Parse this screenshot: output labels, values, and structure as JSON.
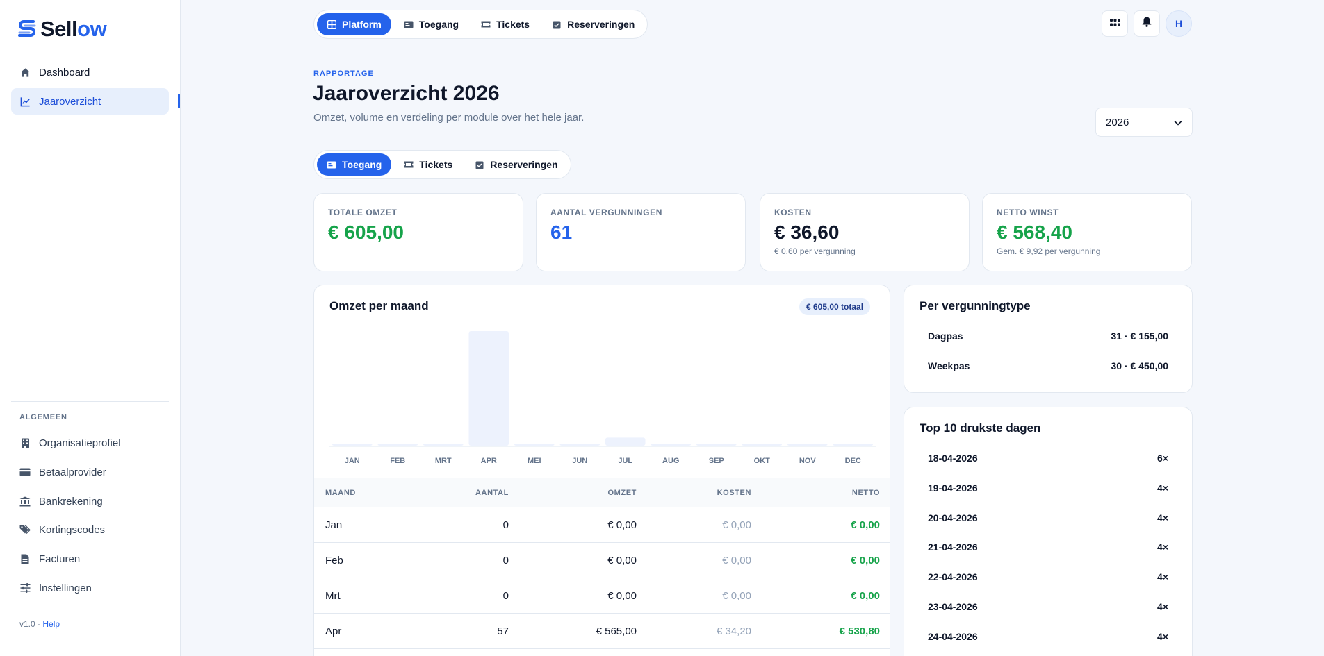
{
  "brand": {
    "prefix": "Sell",
    "suffix": "ow"
  },
  "sidebar": {
    "nav": [
      {
        "label": "Dashboard",
        "icon": "home-icon"
      },
      {
        "label": "Jaaroverzicht",
        "icon": "chart-line-icon"
      }
    ],
    "section_label": "ALGEMEEN",
    "settings": [
      {
        "label": "Organisatieprofiel",
        "icon": "building-icon"
      },
      {
        "label": "Betaalprovider",
        "icon": "credit-card-icon"
      },
      {
        "label": "Bankrekening",
        "icon": "bank-icon"
      },
      {
        "label": "Kortingscodes",
        "icon": "tags-icon"
      },
      {
        "label": "Facturen",
        "icon": "file-icon"
      },
      {
        "label": "Instellingen",
        "icon": "sliders-icon"
      }
    ],
    "version": "v1.0 ·",
    "help": "Help"
  },
  "topnav": {
    "tabs": [
      "Platform",
      "Toegang",
      "Tickets",
      "Reserveringen"
    ],
    "active": "Platform",
    "avatar": "H"
  },
  "header": {
    "eyebrow": "RAPPORTAGE",
    "title": "Jaaroverzicht 2026",
    "subtitle": "Omzet, volume en verdeling per module over het hele jaar.",
    "year": "2026"
  },
  "subnav": {
    "tabs": [
      "Toegang",
      "Tickets",
      "Reserveringen"
    ],
    "active": "Toegang"
  },
  "kpis": [
    {
      "label": "TOTALE OMZET",
      "value": "€ 605,00",
      "sub": "",
      "color": "#16a34a"
    },
    {
      "label": "AANTAL VERGUNNINGEN",
      "value": "61",
      "sub": "",
      "color": "#2563eb"
    },
    {
      "label": "KOSTEN",
      "value": "€ 36,60",
      "sub": "€ 0,60 per vergunning",
      "color": "#0f172a"
    },
    {
      "label": "NETTO WINST",
      "value": "€ 568,40",
      "sub": "Gem. € 9,92 per vergunning",
      "color": "#16a34a"
    }
  ],
  "chart_card": {
    "title": "Omzet per maand",
    "badge": "€ 605,00 totaal"
  },
  "chart_data": {
    "type": "bar",
    "categories": [
      "JAN",
      "FEB",
      "MRT",
      "APR",
      "MEI",
      "JUN",
      "JUL",
      "AUG",
      "SEP",
      "OKT",
      "NOV",
      "DEC"
    ],
    "values": [
      0,
      0,
      0,
      565,
      0,
      0,
      40,
      0,
      0,
      0,
      0,
      0
    ],
    "title": "Omzet per maand",
    "xlabel": "",
    "ylabel": "",
    "ylim": [
      0,
      565
    ],
    "grid": false,
    "bar_color": "#edf2fd",
    "baseline_color": "#e2e8f0"
  },
  "table": {
    "headers": [
      "MAAND",
      "AANTAL",
      "OMZET",
      "KOSTEN",
      "NETTO"
    ],
    "rows": [
      [
        "Jan",
        "0",
        "€ 0,00",
        "€ 0,00",
        "€ 0,00"
      ],
      [
        "Feb",
        "0",
        "€ 0,00",
        "€ 0,00",
        "€ 0,00"
      ],
      [
        "Mrt",
        "0",
        "€ 0,00",
        "€ 0,00",
        "€ 0,00"
      ],
      [
        "Apr",
        "57",
        "€ 565,00",
        "€ 34,20",
        "€ 530,80"
      ]
    ]
  },
  "types": {
    "title": "Per vergunningtype",
    "rows": [
      {
        "label": "Dagpas",
        "value": "31 · € 155,00"
      },
      {
        "label": "Weekpas",
        "value": "30 · € 450,00"
      }
    ]
  },
  "top_days": {
    "title": "Top 10 drukste dagen",
    "rows": [
      {
        "date": "18-04-2026",
        "count": "6×"
      },
      {
        "date": "19-04-2026",
        "count": "4×"
      },
      {
        "date": "20-04-2026",
        "count": "4×"
      },
      {
        "date": "21-04-2026",
        "count": "4×"
      },
      {
        "date": "22-04-2026",
        "count": "4×"
      },
      {
        "date": "23-04-2026",
        "count": "4×"
      },
      {
        "date": "24-04-2026",
        "count": "4×"
      }
    ]
  },
  "colors": {
    "accent": "#2563eb",
    "positive": "#16a34a",
    "muted": "#64748b"
  }
}
